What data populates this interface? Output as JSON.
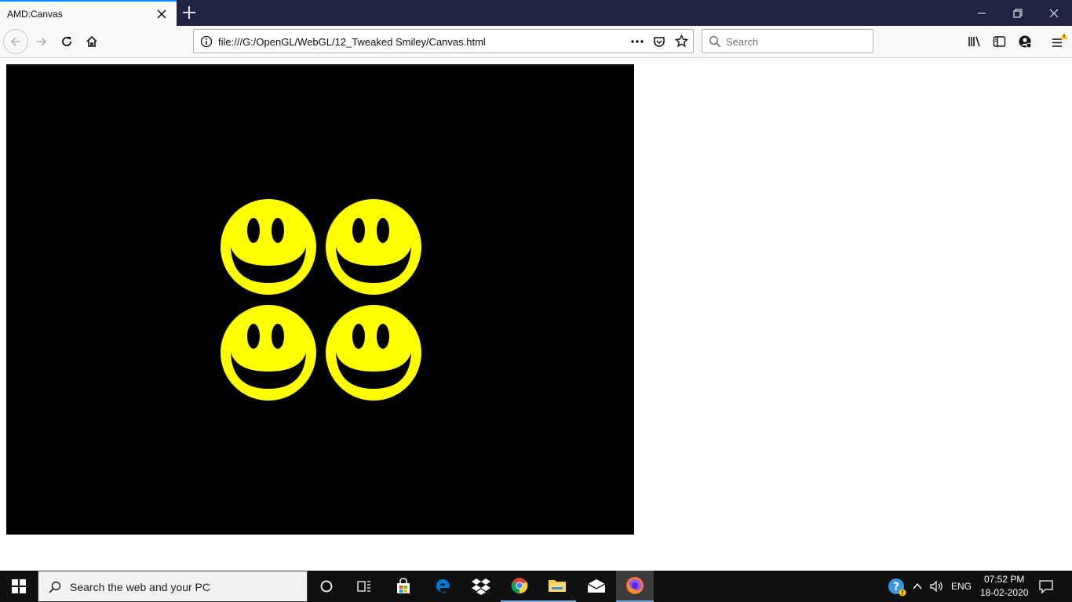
{
  "browser": {
    "tab_title": "AMD:Canvas",
    "url": "file:///G:/OpenGL/WebGL/12_Tweaked Smiley/Canvas.html",
    "search_placeholder": "Search",
    "icons": [
      "back-icon",
      "forward-icon",
      "reload-icon",
      "home-icon",
      "info-icon",
      "page-actions-icon",
      "pocket-icon",
      "bookmark-star-icon",
      "search-icon",
      "library-icon",
      "sidebar-icon",
      "account-icon",
      "menu-icon"
    ]
  },
  "canvas": {
    "background": "#000000",
    "smiley_color": "#ffff00",
    "smiley_count": 4
  },
  "taskbar": {
    "search_placeholder": "Search the web and your PC",
    "language": "ENG",
    "time": "07:52 PM",
    "date": "18-02-2020",
    "apps": [
      "cortana",
      "task-view",
      "store",
      "edge",
      "dropbox",
      "chrome",
      "file-explorer",
      "mail",
      "firefox"
    ]
  }
}
